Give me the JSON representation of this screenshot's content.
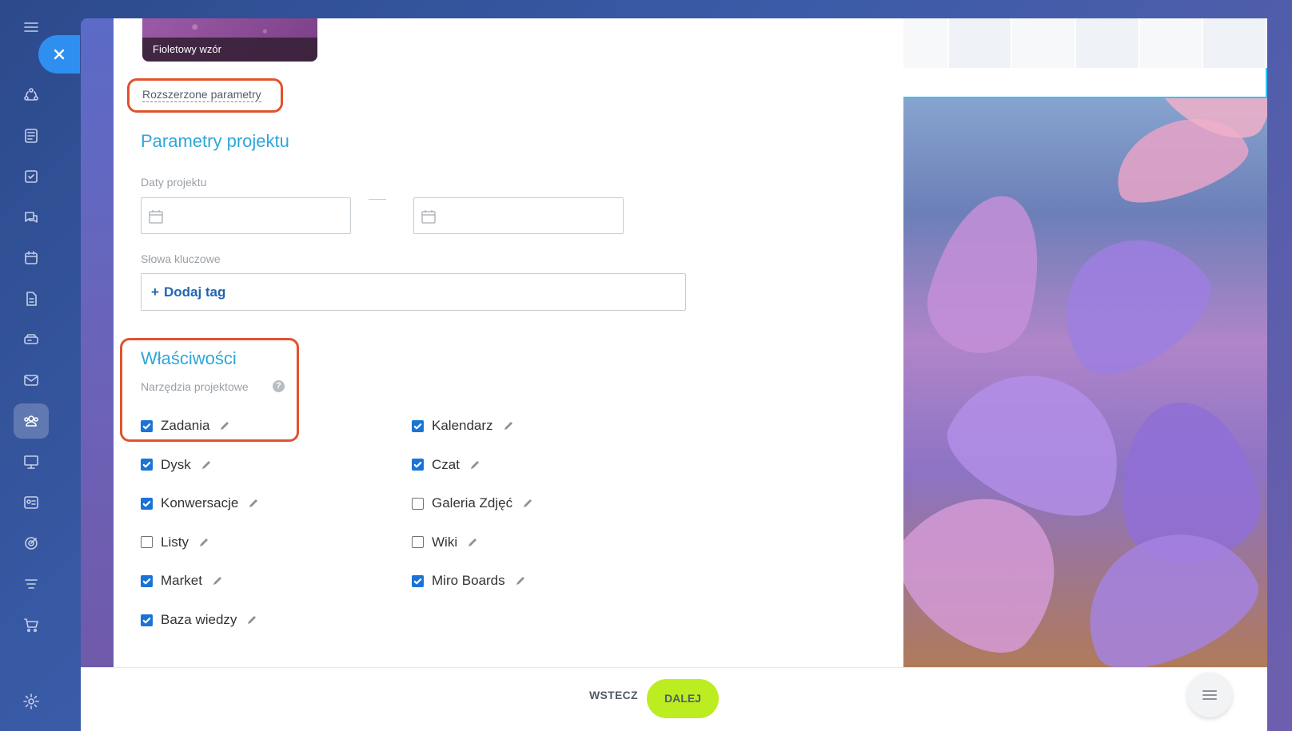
{
  "template": {
    "caption": "Fioletowy wzór"
  },
  "advanced_link": "Rozszerzone parametry",
  "project_params": {
    "title": "Parametry projektu",
    "dates_label": "Daty projektu",
    "keywords_label": "Słowa kluczowe",
    "add_tag_label": "Dodaj tag",
    "add_tag_plus": "+"
  },
  "features": {
    "title": "Właściwości",
    "tools_label": "Narzędzia projektowe",
    "help": "?",
    "items": [
      {
        "label": "Zadania",
        "checked": true
      },
      {
        "label": "Kalendarz",
        "checked": true
      },
      {
        "label": "Dysk",
        "checked": true
      },
      {
        "label": "Czat",
        "checked": true
      },
      {
        "label": "Konwersacje",
        "checked": true
      },
      {
        "label": "Galeria Zdjęć",
        "checked": false
      },
      {
        "label": "Listy",
        "checked": false
      },
      {
        "label": "Wiki",
        "checked": false
      },
      {
        "label": "Market",
        "checked": true
      },
      {
        "label": "Miro Boards",
        "checked": true
      },
      {
        "label": "Baza wiedzy",
        "checked": true
      }
    ]
  },
  "footer": {
    "back_label": "WSTECZ",
    "next_label": "DALEJ"
  },
  "colors": {
    "accent": "#2fa6d8",
    "checkbox": "#1a73d6",
    "next_button": "#bbed21",
    "highlight": "#e0532c"
  },
  "icons": [
    "menu-icon",
    "close-icon",
    "connections-icon",
    "feed-icon",
    "tasks-icon",
    "chat-icon",
    "calendar-icon",
    "docs-icon",
    "drive-icon",
    "mail-icon",
    "groups-icon",
    "presentation-icon",
    "crm-icon",
    "target-icon",
    "automation-icon",
    "cart-icon",
    "settings-icon",
    "list-icon",
    "pencil-icon"
  ]
}
